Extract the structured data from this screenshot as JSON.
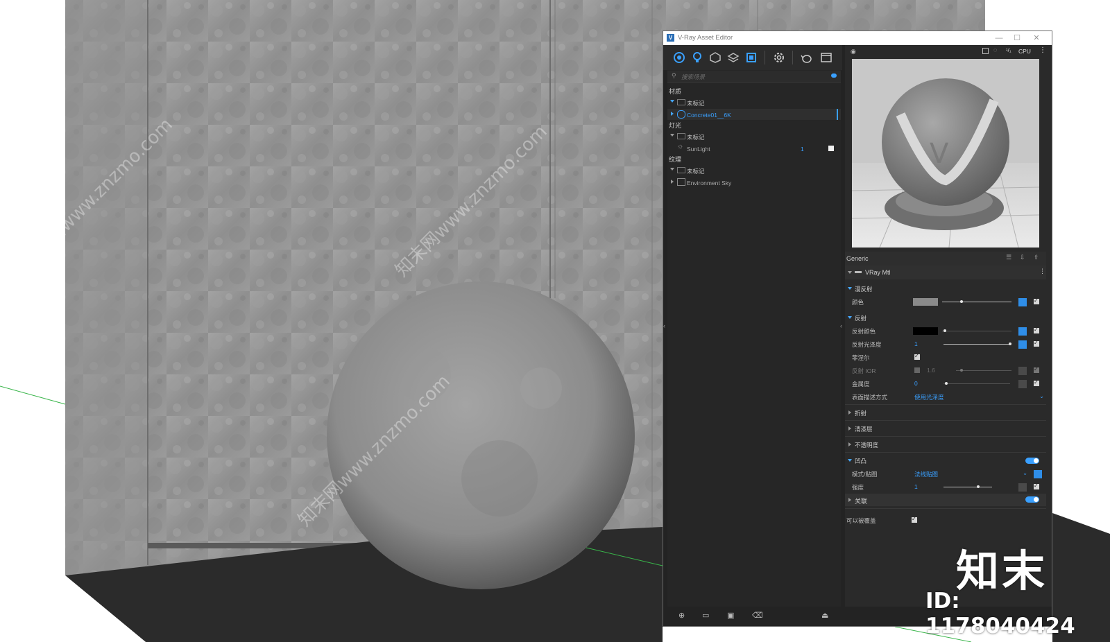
{
  "window": {
    "title": "V-Ray Asset Editor",
    "logo": "V"
  },
  "search": {
    "placeholder": "搜索场景"
  },
  "tree": {
    "materials": {
      "label": "材质",
      "group": "未标记",
      "item": "Concrete01__6K"
    },
    "lights": {
      "label": "灯光",
      "group": "未标记",
      "item": "SunLight",
      "count": "1"
    },
    "textures": {
      "label": "纹理",
      "group": "未标记",
      "item": "Environment Sky"
    }
  },
  "preview": {
    "engine": "CPU"
  },
  "material": {
    "generic": "Generic",
    "type": "VRay Mtl",
    "diffuse": {
      "header": "漫反射",
      "color_label": "颜色",
      "color": "#8a8a8a"
    },
    "reflection": {
      "header": "反射",
      "color_label": "反射颜色",
      "color": "#000000",
      "gloss_label": "反射光泽度",
      "gloss_value": "1",
      "fresnel_label": "菲涅尔",
      "ior_label": "反射 IOR",
      "ior_value": "1.6",
      "metal_label": "金属度",
      "metal_value": "0",
      "brdf_label": "表面描述方式",
      "brdf_value": "使用光泽度"
    },
    "collapsed": [
      "折射",
      "清漆层",
      "不透明度"
    ],
    "bump": {
      "header": "凹凸",
      "mode_label": "模式/贴图",
      "mode_value": "法线贴图",
      "amount_label": "强度",
      "amount_value": "1"
    },
    "binding": {
      "header": "关联"
    },
    "override_label": "可以被覆盖"
  },
  "watermark": {
    "brand": "知末",
    "id": "ID: 1178040424",
    "site": "知末网www.znzmo.com"
  },
  "colors": {
    "accent": "#3aa0ff",
    "panel": "#232323",
    "concrete": "#9a9a9a"
  }
}
